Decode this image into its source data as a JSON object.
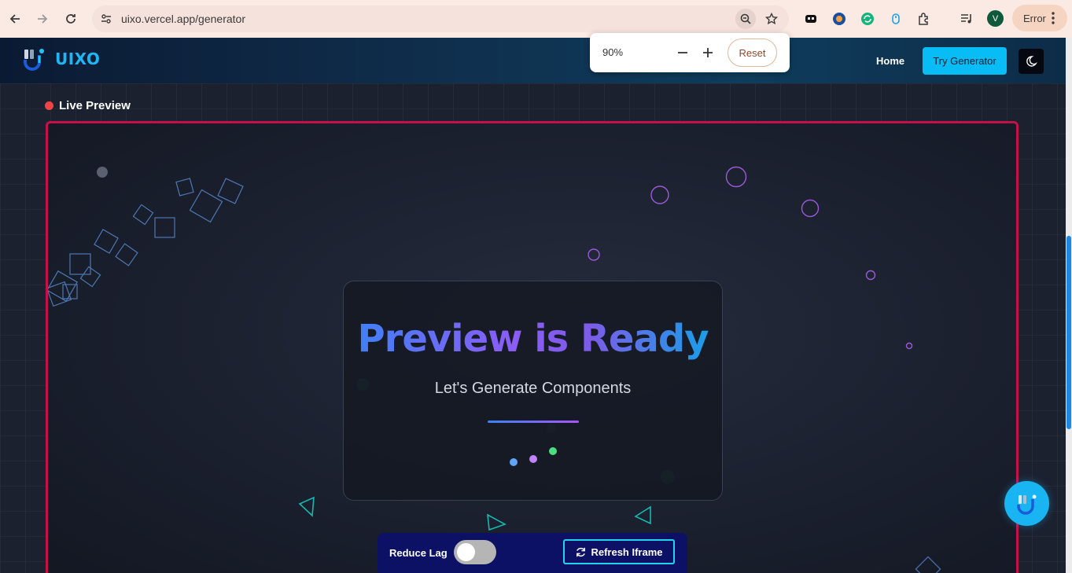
{
  "browser": {
    "url": "uixo.vercel.app/generator",
    "profile_initial": "V",
    "error_label": "Error",
    "zoom": {
      "value": "90%",
      "reset_label": "Reset"
    }
  },
  "header": {
    "logo_text": "UIXO",
    "nav": {
      "home": "Home",
      "try_generator": "Try Generator"
    }
  },
  "preview": {
    "live_label": "Live Preview",
    "title": "Preview is Ready",
    "subtitle": "Let's Generate Components",
    "loader_colors": [
      "#60a5fa",
      "#c084fc",
      "#4ade80"
    ]
  },
  "controls": {
    "reduce_lag_label": "Reduce Lag",
    "reduce_lag_on": false,
    "refresh_label": "Refresh Iframe"
  },
  "colors": {
    "accent": "#08bdf5",
    "frame_border": "#c5114a",
    "live_dot": "#ef4444",
    "control_bar": "#0d1166"
  }
}
